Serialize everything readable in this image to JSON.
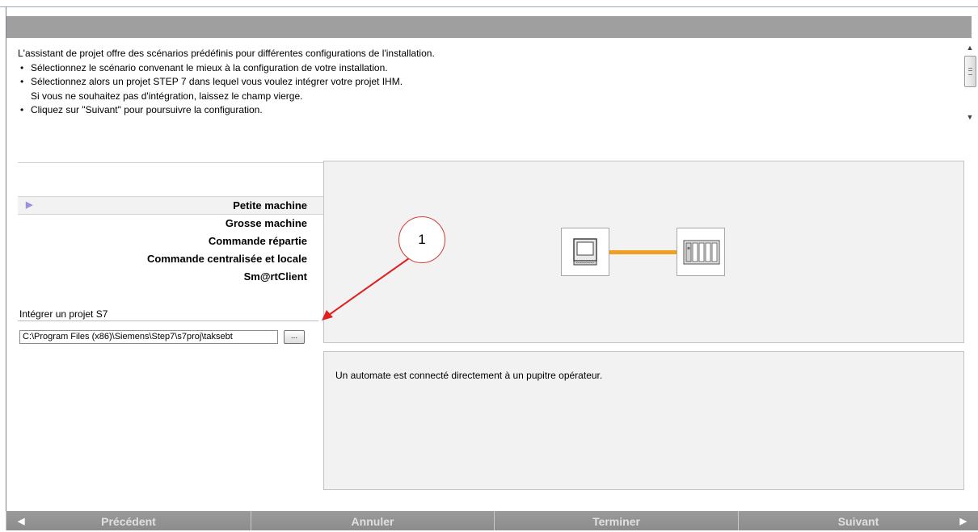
{
  "intro": {
    "lead": "L'assistant de projet offre des scénarios prédéfinis pour différentes configurations de l'installation.",
    "bullets": [
      "Sélectionnez le scénario convenant le mieux à la configuration de votre installation.",
      "Sélectionnez alors un projet STEP 7 dans lequel vous voulez intégrer votre projet IHM.",
      "Cliquez sur \"Suivant\" pour poursuivre la configuration."
    ],
    "bullet2_sub": "Si vous ne souhaitez pas d'intégration, laissez le champ vierge."
  },
  "scenarios": [
    {
      "label": "Petite machine",
      "selected": true
    },
    {
      "label": "Grosse machine",
      "selected": false
    },
    {
      "label": "Commande répartie",
      "selected": false
    },
    {
      "label": "Commande centralisée et locale",
      "selected": false
    },
    {
      "label": "Sm@rtClient",
      "selected": false
    }
  ],
  "s7": {
    "label": "Intégrer un projet S7",
    "path": "C:\\Program Files (x86)\\Siemens\\Step7\\s7proj\\taksebt",
    "browse_label": "..."
  },
  "description": "Un automate est connecté directement à un pupitre opérateur.",
  "callout": "1",
  "footer": {
    "previous": "Précédent",
    "cancel": "Annuler",
    "finish": "Terminer",
    "next": "Suivant"
  },
  "colors": {
    "header": "#9f9f9f",
    "panel": "#f2f2f2",
    "connector": "#f0a020",
    "callout": "#d43a3a",
    "footer": "#939393",
    "selection_marker": "#9b8fe0"
  },
  "icons": {
    "hmi": "operator-panel-icon",
    "plc": "plc-rack-icon"
  }
}
